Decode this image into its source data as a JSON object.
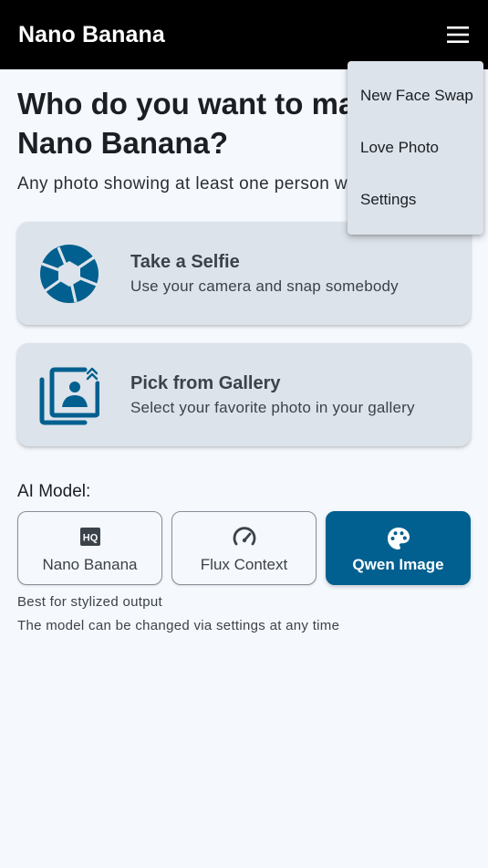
{
  "appbar": {
    "title": "Nano Banana",
    "menu_icon": "hamburger-menu-icon"
  },
  "main": {
    "headline": "Who do you want to make Nano Banana?",
    "subtitle": "Any photo showing at least one person will work"
  },
  "cards": [
    {
      "icon": "camera-shutter-icon",
      "title": "Take a Selfie",
      "description": "Use your camera and snap somebody"
    },
    {
      "icon": "gallery-photos-icon",
      "title": "Pick from Gallery",
      "description": "Select your favorite photo in your gallery"
    }
  ],
  "model_section": {
    "label": "AI Model:",
    "options": [
      {
        "icon": "hq-icon",
        "label": "Nano Banana",
        "selected": false
      },
      {
        "icon": "speedometer-icon",
        "label": "Flux Context",
        "selected": false
      },
      {
        "icon": "palette-icon",
        "label": "Qwen Image",
        "selected": true
      }
    ],
    "selected_description": "Best for stylized output",
    "settings_note": "The model can be changed via settings at any time"
  },
  "menu": {
    "items": [
      "New Face Swap",
      "Love Photo",
      "Settings"
    ]
  },
  "colors": {
    "appbar_bg": "#000000",
    "page_bg": "#f5f9fe",
    "card_bg": "#dde3ea",
    "accent": "#01608f"
  }
}
